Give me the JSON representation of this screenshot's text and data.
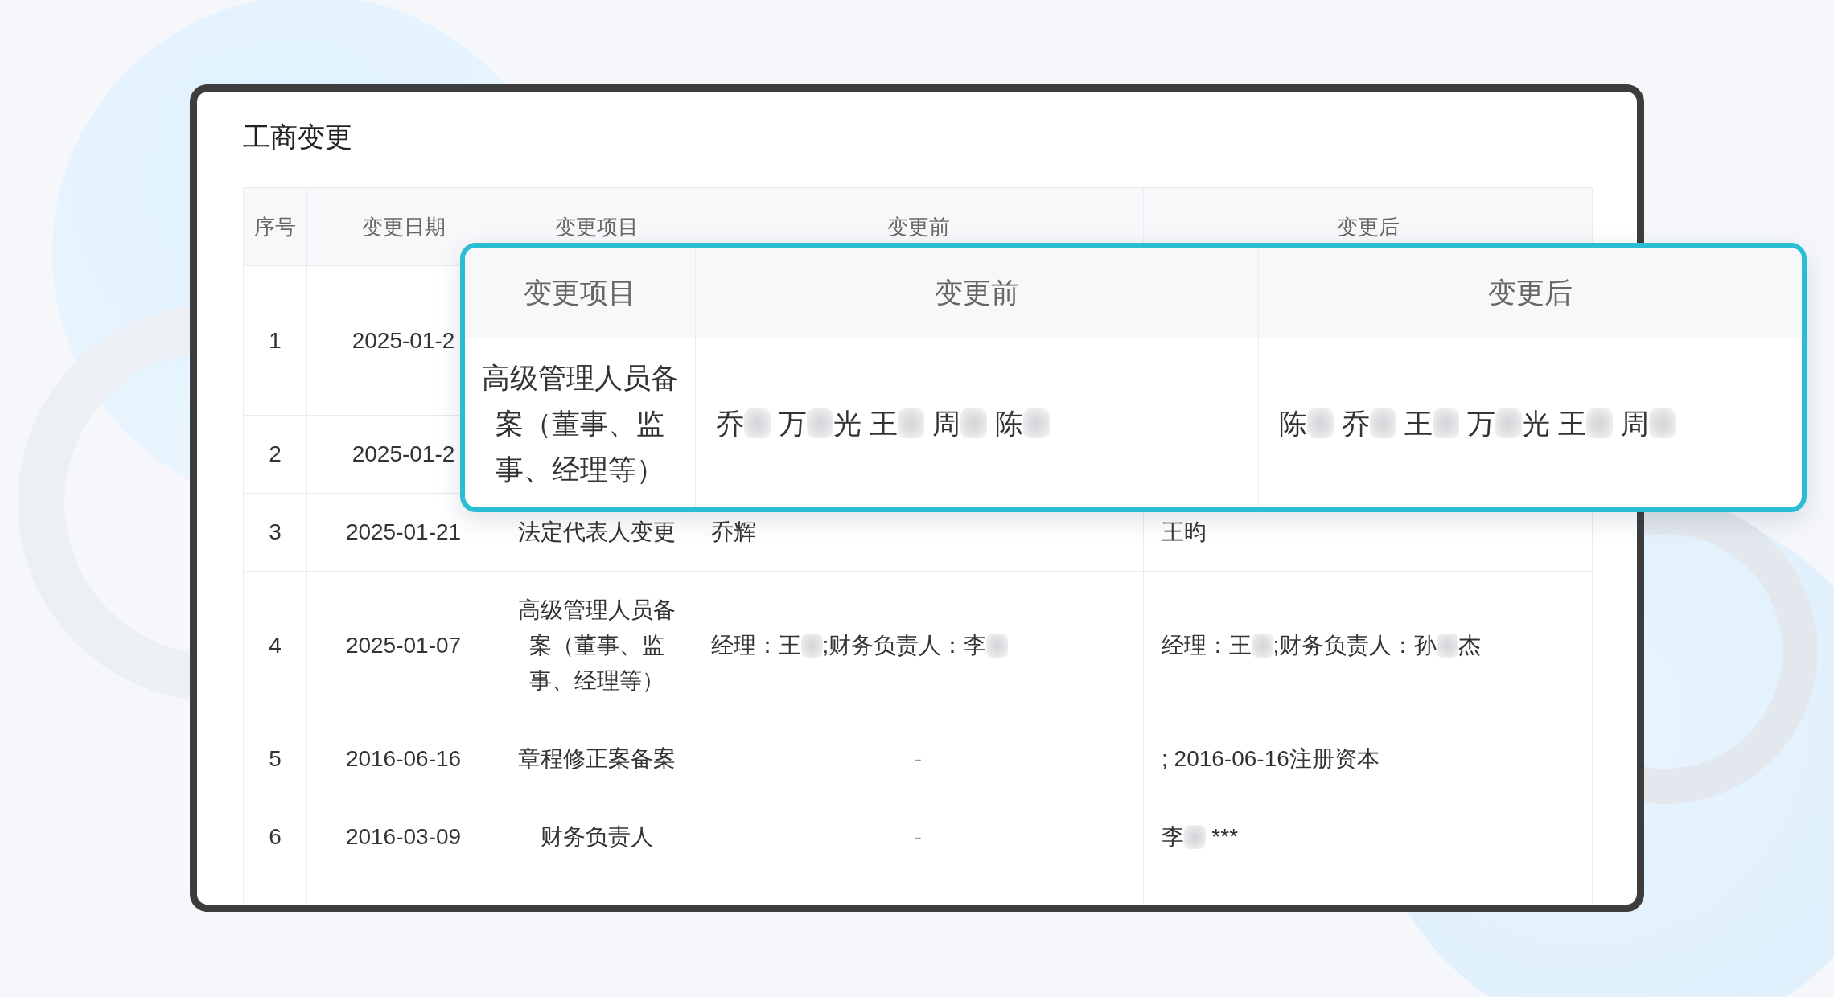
{
  "title": "工商变更",
  "table": {
    "columns": [
      "序号",
      "变更日期",
      "变更项目",
      "变更前",
      "变更后"
    ],
    "rows": [
      {
        "no": "1",
        "date": "2025-01-2"
      },
      {
        "no": "2",
        "date": "2025-01-2"
      },
      {
        "no": "3",
        "date": "2025-01-21",
        "item": "法定代表人变更",
        "before": [
          {
            "kind": "text",
            "text": "乔辉"
          }
        ],
        "after": [
          {
            "kind": "text",
            "text": "王昀"
          }
        ]
      },
      {
        "no": "4",
        "date": "2025-01-07",
        "item": "高级管理人员备案（董事、监事、经理等）",
        "before": [
          {
            "kind": "text",
            "text": "经理：王"
          },
          {
            "kind": "redacted"
          },
          {
            "kind": "text",
            "text": ";财务负责人：李"
          },
          {
            "kind": "redacted"
          }
        ],
        "after": [
          {
            "kind": "text",
            "text": "经理：王"
          },
          {
            "kind": "redacted"
          },
          {
            "kind": "text",
            "text": ";财务负责人：孙"
          },
          {
            "kind": "redacted"
          },
          {
            "kind": "text",
            "text": "杰"
          }
        ]
      },
      {
        "no": "5",
        "date": "2016-06-16",
        "item": "章程修正案备案",
        "before": [
          {
            "kind": "dash",
            "text": "-"
          }
        ],
        "after": [
          {
            "kind": "text",
            "text": "; 2016-06-16注册资本"
          }
        ]
      },
      {
        "no": "6",
        "date": "2016-03-09",
        "item": "财务负责人",
        "before": [
          {
            "kind": "dash",
            "text": "-"
          }
        ],
        "after": [
          {
            "kind": "text",
            "text": "李"
          },
          {
            "kind": "redacted"
          },
          {
            "kind": "text",
            "text": " ***"
          }
        ]
      }
    ]
  },
  "callout": {
    "columns": [
      "变更项目",
      "变更前",
      "变更后"
    ],
    "row": {
      "item": "高级管理人员备案（董事、监事、经理等）",
      "before": [
        {
          "kind": "text",
          "text": "乔"
        },
        {
          "kind": "redacted"
        },
        {
          "kind": "text",
          "text": " 万"
        },
        {
          "kind": "redacted"
        },
        {
          "kind": "text",
          "text": "光 王"
        },
        {
          "kind": "redacted"
        },
        {
          "kind": "text",
          "text": " 周"
        },
        {
          "kind": "redacted"
        },
        {
          "kind": "text",
          "text": " 陈"
        },
        {
          "kind": "redacted"
        }
      ],
      "after": [
        {
          "kind": "text",
          "text": "陈"
        },
        {
          "kind": "redacted"
        },
        {
          "kind": "text",
          "text": " 乔"
        },
        {
          "kind": "redacted"
        },
        {
          "kind": "text",
          "text": " 王"
        },
        {
          "kind": "redacted"
        },
        {
          "kind": "text",
          "text": " 万"
        },
        {
          "kind": "redacted"
        },
        {
          "kind": "text",
          "text": "光 王"
        },
        {
          "kind": "redacted"
        },
        {
          "kind": "text",
          "text": " 周"
        },
        {
          "kind": "redacted"
        }
      ]
    }
  }
}
